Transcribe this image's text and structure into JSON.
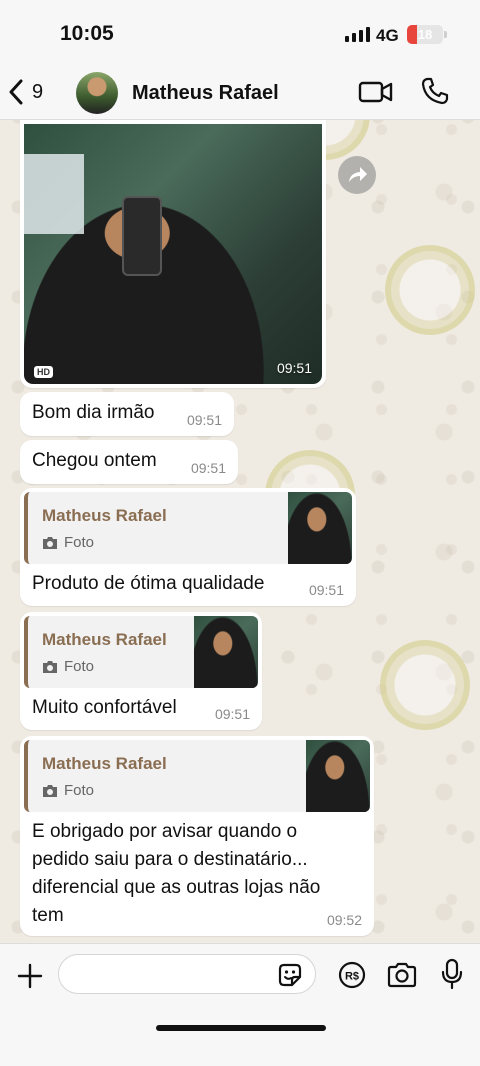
{
  "status_bar": {
    "time": "10:05",
    "network": "4G",
    "battery": "18"
  },
  "header": {
    "back_count": "9",
    "contact_name": "Matheus Rafael"
  },
  "messages": [
    {
      "type": "photo",
      "time": "09:51",
      "badge": "HD"
    },
    {
      "type": "text",
      "text": "Bom dia irmão",
      "time": "09:51"
    },
    {
      "type": "text",
      "text": "Chegou ontem",
      "time": "09:51"
    },
    {
      "type": "reply",
      "quote_author": "Matheus Rafael",
      "quote_label": "Foto",
      "text": "Produto de ótima qualidade",
      "time": "09:51"
    },
    {
      "type": "reply",
      "quote_author": "Matheus Rafael",
      "quote_label": "Foto",
      "text": "Muito confortável",
      "time": "09:51"
    },
    {
      "type": "reply",
      "quote_author": "Matheus Rafael",
      "quote_label": "Foto",
      "text_lines": [
        "E obrigado por avisar quando o",
        "pedido saiu para o destinatário...",
        "diferencial que as outras lojas não",
        "tem"
      ],
      "time": "09:52"
    }
  ],
  "input": {
    "value": "",
    "placeholder": ""
  },
  "colors": {
    "accent": "#8a6e52",
    "background": "#efeae2",
    "battery": "#e8453c"
  },
  "icons": [
    "back-chevron-icon",
    "video-call-icon",
    "phone-icon",
    "forward-icon",
    "camera-icon",
    "plus-icon",
    "sticker-icon",
    "payment-icon",
    "microphone-icon"
  ]
}
